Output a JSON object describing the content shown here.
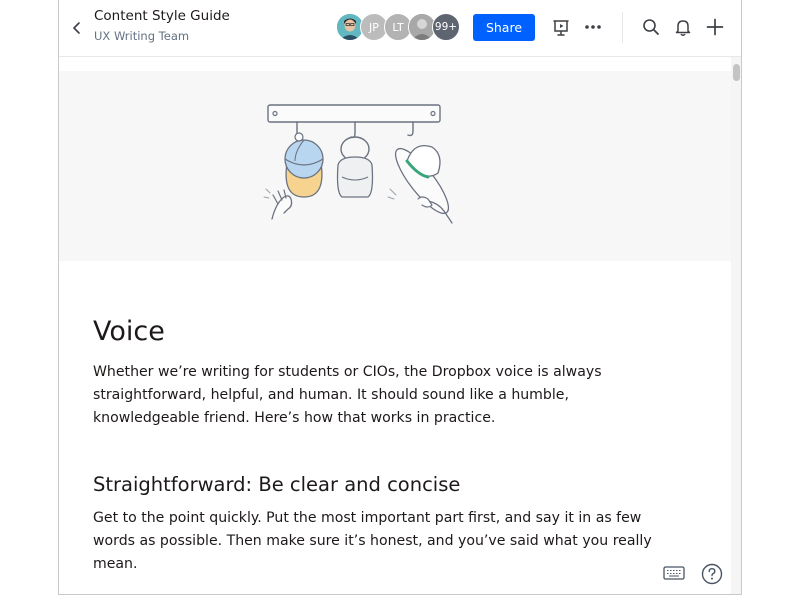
{
  "header": {
    "title": "Content Style Guide",
    "subtitle": "UX Writing Team",
    "share_label": "Share",
    "avatars": [
      {
        "kind": "photo",
        "label": "",
        "color": "#5bb5c0"
      },
      {
        "kind": "initials",
        "label": "JP",
        "color": "#bcbcbc"
      },
      {
        "kind": "initials",
        "label": "LT",
        "color": "#b3b3b3"
      },
      {
        "kind": "photo",
        "label": "",
        "color": "#9a9a9a"
      },
      {
        "kind": "count",
        "label": "99+",
        "color": "#5e6470"
      }
    ],
    "icons": [
      "back-icon",
      "present-icon",
      "more-icon",
      "search-icon",
      "bell-icon",
      "plus-icon"
    ]
  },
  "doc": {
    "heading": "Voice",
    "intro_lines": [
      "Whether we’re writing for students or CIOs, the Dropbox voice is always",
      "straightforward, helpful, and human. It should sound like a humble,",
      "knowledgeable friend. Here’s how that works in practice."
    ],
    "subheading": "Straightforward: Be clear and concise",
    "body_lines": [
      "Get to the point quickly. Put the most important part first, and say it in as few",
      "words as possible. Then make sure it’s honest, and you’ve said what you really",
      "mean."
    ]
  },
  "floating": [
    "keyboard-icon",
    "help-icon"
  ],
  "colors": {
    "accent": "#0061fe",
    "hero_bg": "#f7f7f7"
  }
}
